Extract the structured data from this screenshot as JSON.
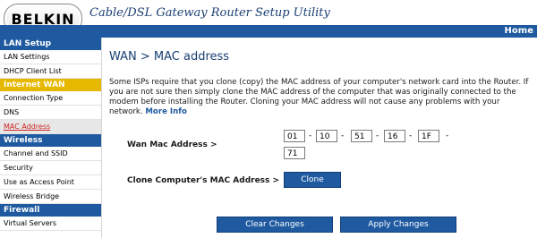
{
  "header": {
    "logo_text": "BELKIN",
    "utility_title": "Cable/DSL Gateway Router Setup Utility",
    "home_label": "Home"
  },
  "sidebar": {
    "sections": [
      {
        "label": "LAN Setup",
        "items": [
          "LAN Settings",
          "DHCP Client List"
        ]
      },
      {
        "label": "Internet WAN",
        "items": [
          "Connection Type",
          "DNS",
          "MAC Address"
        ]
      },
      {
        "label": "Wireless",
        "items": [
          "Channel and SSID",
          "Security",
          "Use as Access Point",
          "Wireless Bridge"
        ]
      },
      {
        "label": "Firewall",
        "items": [
          "Virtual Servers"
        ]
      }
    ]
  },
  "main": {
    "title": "WAN > MAC address",
    "description": "Some ISPs require that you clone (copy) the MAC address of your computer's network card into the Router. If you are not sure then simply clone the MAC address of the computer that was originally connected to the modem before installing the Router. Cloning your MAC address will not cause any problems with your network.",
    "more_info": "More Info",
    "wan_mac_label": "Wan Mac Address >",
    "mac_octets": [
      "01",
      "10",
      "51",
      "16",
      "1F",
      "71"
    ],
    "separator": "-",
    "clone_label": "Clone Computer's MAC Address >",
    "clone_button": "Clone",
    "clear_button": "Clear Changes",
    "apply_button": "Apply Changes"
  },
  "colors": {
    "primary_blue": "#1f5aa0",
    "active_section": "#e6b800",
    "current_item": "#cc2222"
  }
}
